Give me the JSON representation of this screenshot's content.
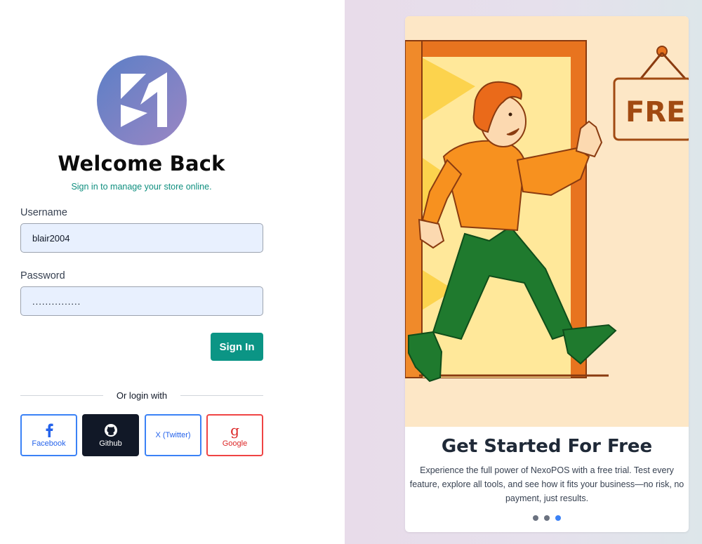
{
  "header": {
    "title": "Welcome Back",
    "subtitle": "Sign in to manage your store online."
  },
  "form": {
    "username_label": "Username",
    "username_value": "blair2004",
    "password_label": "Password",
    "password_value": "...............",
    "signin_label": "Sign In"
  },
  "social": {
    "divider_text": "Or login with",
    "facebook": "Facebook",
    "github": "Github",
    "twitter": "X (Twitter)",
    "google": "Google"
  },
  "promo": {
    "sign_text": "FRE",
    "title": "Get Started For Free",
    "description": "Experience the full power of NexoPOS with a free trial. Test every feature, explore all tools, and see how it fits your business—no risk, no payment, just results.",
    "slides": 3,
    "active_slide": 3
  },
  "colors": {
    "accent": "#0b9585",
    "facebook": "#3b82f6",
    "github": "#111827",
    "google": "#ef4444"
  }
}
